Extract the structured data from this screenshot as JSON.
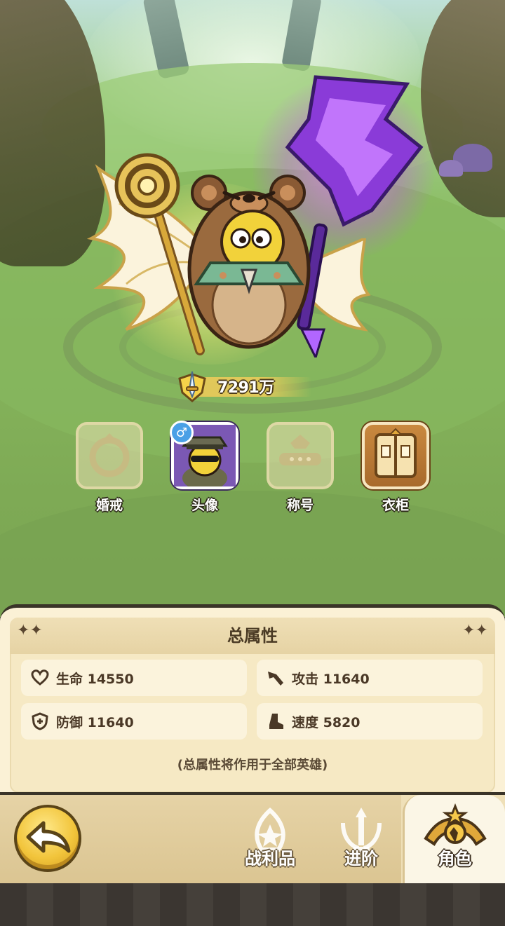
{
  "power": {
    "value": "7291万"
  },
  "slots": [
    {
      "label": "婚戒",
      "state": "locked"
    },
    {
      "label": "头像",
      "state": "equipped",
      "badge": "♂"
    },
    {
      "label": "称号",
      "state": "locked"
    },
    {
      "label": "衣柜",
      "state": "available"
    }
  ],
  "stats_panel": {
    "title": "总属性",
    "stats": [
      {
        "icon": "heart-icon",
        "text": "生命 14550"
      },
      {
        "icon": "attack-icon",
        "text": "攻击 11640"
      },
      {
        "icon": "shield-icon",
        "text": "防御 11640"
      },
      {
        "icon": "boot-icon",
        "text": "速度 5820"
      }
    ],
    "note": "(总属性将作用于全部英雄)"
  },
  "nav": {
    "tabs": [
      {
        "label": "战利品",
        "icon": "loot-icon",
        "active": false
      },
      {
        "label": "进阶",
        "icon": "advance-icon",
        "active": false
      },
      {
        "label": "角色",
        "icon": "character-icon",
        "active": true
      }
    ]
  },
  "colors": {
    "panel_bg": "#fbf1d6",
    "accent_gold": "#f2c53c",
    "avatar_bg": "#6a4aa0",
    "badge_blue": "#4aa0e6"
  }
}
